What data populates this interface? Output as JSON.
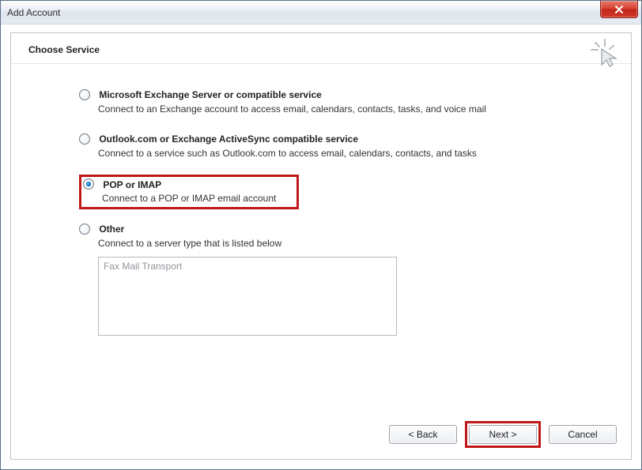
{
  "window": {
    "title": "Add Account"
  },
  "header": {
    "title": "Choose Service"
  },
  "options": {
    "exchange": {
      "label": "Microsoft Exchange Server or compatible service",
      "desc": "Connect to an Exchange account to access email, calendars, contacts, tasks, and voice mail",
      "selected": false
    },
    "activesync": {
      "label": "Outlook.com or Exchange ActiveSync compatible service",
      "desc": "Connect to a service such as Outlook.com to access email, calendars, contacts, and tasks",
      "selected": false
    },
    "popimap": {
      "label": "POP or IMAP",
      "desc": "Connect to a POP or IMAP email account",
      "selected": true
    },
    "other": {
      "label": "Other",
      "desc": "Connect to a server type that is listed below",
      "selected": false,
      "list_items": [
        "Fax Mail Transport"
      ]
    }
  },
  "buttons": {
    "back": "< Back",
    "next": "Next >",
    "cancel": "Cancel"
  }
}
